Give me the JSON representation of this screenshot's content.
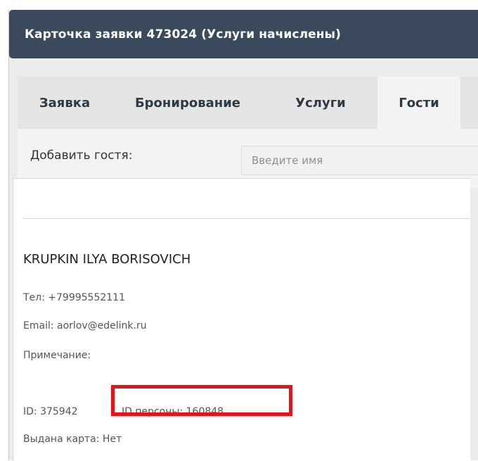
{
  "window": {
    "title": "Карточка заявки 473024 (Услуги начислены)"
  },
  "tabs": [
    {
      "label": "Заявка",
      "active": false
    },
    {
      "label": "Бронирование",
      "active": false
    },
    {
      "label": "Услуги",
      "active": false
    },
    {
      "label": "Гости",
      "active": true
    }
  ],
  "add_guest": {
    "label": "Добавить гостя:",
    "placeholder": "Введите имя"
  },
  "guest": {
    "name": "KRUPKIN ILYA BORISOVICH",
    "phone": "Тел: +79995552111",
    "email": "Email: aorlov@edelink.ru",
    "note": "Примечание:",
    "id": "ID: 375942",
    "person_id": "ID персоны: 160848",
    "card": "Выдана карта: Нет"
  },
  "colors": {
    "titlebar": "#3a4a5c",
    "highlight_border": "#e0141b"
  }
}
